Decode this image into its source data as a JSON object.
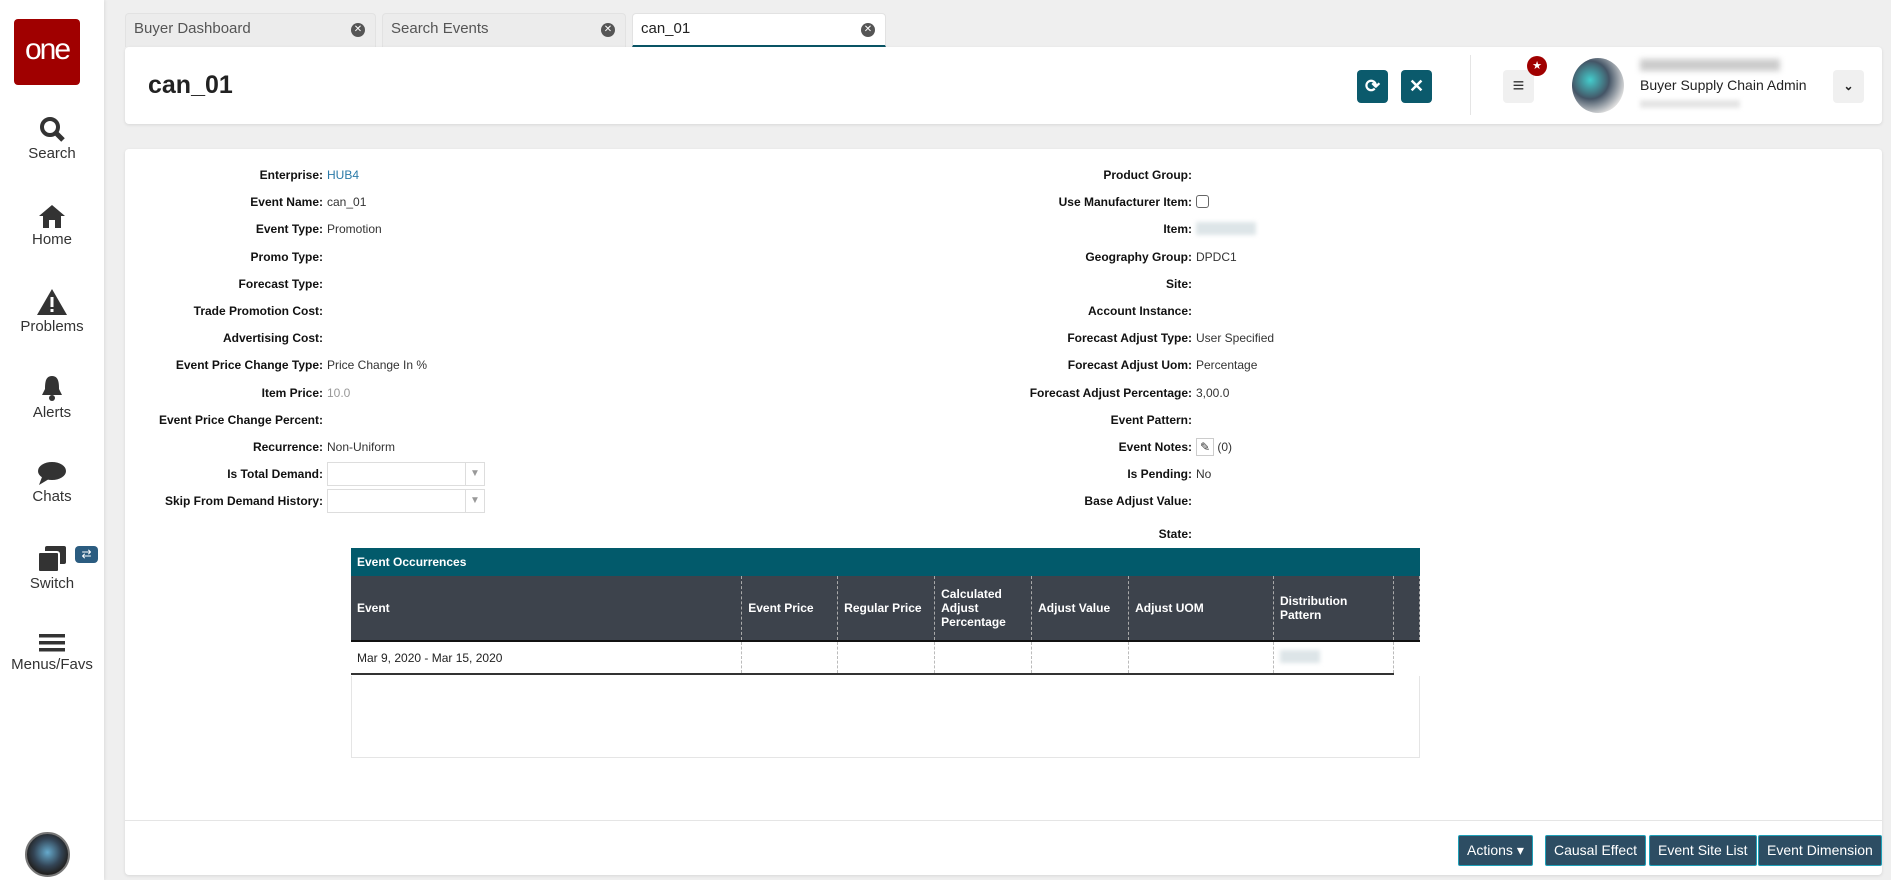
{
  "logo": "one",
  "sidebar": [
    {
      "label": "Search",
      "icon": "search-icon"
    },
    {
      "label": "Home",
      "icon": "home-icon"
    },
    {
      "label": "Problems",
      "icon": "warning-icon"
    },
    {
      "label": "Alerts",
      "icon": "bell-icon"
    },
    {
      "label": "Chats",
      "icon": "chat-icon"
    },
    {
      "label": "Switch",
      "icon": "switch-icon"
    },
    {
      "label": "Menus/Favs",
      "icon": "menu-icon"
    }
  ],
  "tabs": [
    {
      "label": "Buyer Dashboard"
    },
    {
      "label": "Search Events"
    },
    {
      "label": "can_01"
    }
  ],
  "header": {
    "title": "can_01",
    "user_role": "Buyer Supply Chain Admin"
  },
  "left_fields": [
    {
      "label": "Enterprise:",
      "value": "HUB4"
    },
    {
      "label": "Event Name:",
      "value": "can_01"
    },
    {
      "label": "Event Type:",
      "value": "Promotion"
    },
    {
      "label": "Promo Type:",
      "value": ""
    },
    {
      "label": "Forecast Type:",
      "value": ""
    },
    {
      "label": "Trade Promotion Cost:",
      "value": ""
    },
    {
      "label": "Advertising Cost:",
      "value": ""
    },
    {
      "label": "Event Price Change Type:",
      "value": "Price Change In %"
    },
    {
      "label": "Item Price:",
      "value": "10.0"
    },
    {
      "label": "Event Price Change Percent:",
      "value": ""
    },
    {
      "label": "Recurrence:",
      "value": "Non-Uniform"
    },
    {
      "label": "Is Total Demand:",
      "value": ""
    },
    {
      "label": "Skip From Demand History:",
      "value": ""
    }
  ],
  "right_fields": [
    {
      "label": "Product Group:",
      "value": ""
    },
    {
      "label": "Use Manufacturer Item:",
      "value": ""
    },
    {
      "label": "Item:",
      "value": ""
    },
    {
      "label": "Geography Group:",
      "value": "DPDC1"
    },
    {
      "label": "Site:",
      "value": ""
    },
    {
      "label": "Account Instance:",
      "value": ""
    },
    {
      "label": "Forecast Adjust Type:",
      "value": "User Specified"
    },
    {
      "label": "Forecast Adjust Uom:",
      "value": "Percentage"
    },
    {
      "label": "Forecast Adjust Percentage:",
      "value": "3,00.0"
    },
    {
      "label": "Event Pattern:",
      "value": ""
    },
    {
      "label": "Event Notes:",
      "value": "(0)"
    },
    {
      "label": "Is Pending:",
      "value": "No"
    },
    {
      "label": "Base Adjust Value:",
      "value": ""
    },
    {
      "label": "State:",
      "value": ""
    }
  ],
  "occurrences": {
    "title": "Event Occurrences",
    "columns": [
      "Event",
      "Event Price",
      "Regular Price",
      "Calculated Adjust Percentage",
      "Adjust Value",
      "Adjust UOM",
      "Distribution Pattern"
    ],
    "rows": [
      [
        "Mar 9, 2020 - Mar 15, 2020",
        "",
        "",
        "",
        "",
        "",
        ""
      ]
    ]
  },
  "footer": {
    "actions": "Actions",
    "causal": "Causal Effect",
    "site_list": "Event Site List",
    "dimension": "Event Dimension"
  },
  "colors": {
    "accent": "#0b5a6c",
    "brand": "#a00000",
    "table_header": "#3d434c"
  }
}
